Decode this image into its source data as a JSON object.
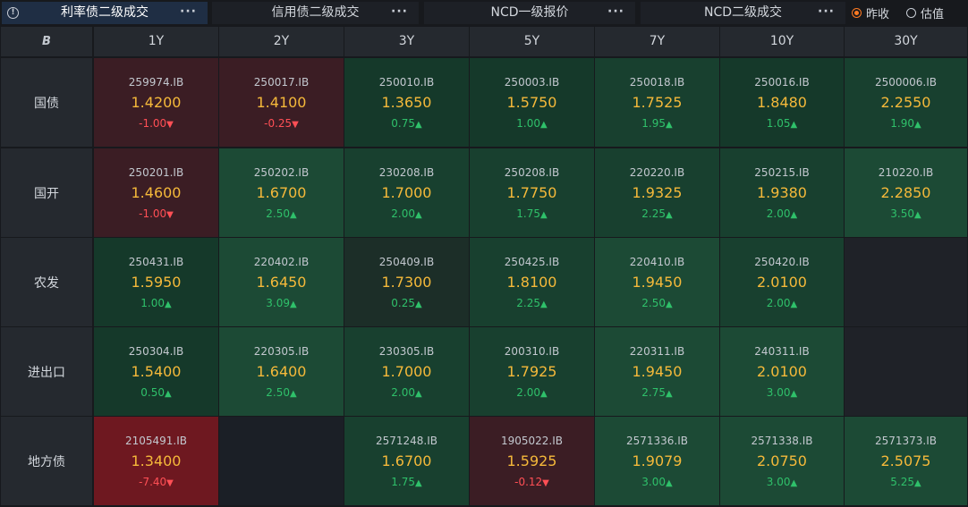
{
  "tabs": [
    {
      "label": "利率债二级成交",
      "active": true
    },
    {
      "label": "信用债二级成交",
      "active": false
    },
    {
      "label": "NCD一级报价",
      "active": false
    },
    {
      "label": "NCD二级成交",
      "active": false
    }
  ],
  "radio": {
    "option1": "昨收",
    "option2": "估值",
    "selected": "昨收"
  },
  "colors": {
    "up": "#2fc06a",
    "down": "#ff4f55",
    "price": "#f5b93a",
    "accent": "#ff7a22"
  },
  "grid": {
    "corner_icon": "B",
    "tenors": [
      "1Y",
      "2Y",
      "3Y",
      "5Y",
      "7Y",
      "10Y",
      "30Y"
    ],
    "rows": [
      {
        "label": "国债",
        "cells": [
          {
            "code": "259974.IB",
            "price": "1.4200",
            "change": "-1.00",
            "dir": "down"
          },
          {
            "code": "250017.IB",
            "price": "1.4100",
            "change": "-0.25",
            "dir": "down"
          },
          {
            "code": "250010.IB",
            "price": "1.3650",
            "change": "0.75",
            "dir": "up"
          },
          {
            "code": "250003.IB",
            "price": "1.5750",
            "change": "1.00",
            "dir": "up"
          },
          {
            "code": "250018.IB",
            "price": "1.7525",
            "change": "1.95",
            "dir": "up"
          },
          {
            "code": "250016.IB",
            "price": "1.8480",
            "change": "1.05",
            "dir": "up"
          },
          {
            "code": "2500006.IB",
            "price": "2.2550",
            "change": "1.90",
            "dir": "up"
          }
        ]
      },
      {
        "label": "国开",
        "cells": [
          {
            "code": "250201.IB",
            "price": "1.4600",
            "change": "-1.00",
            "dir": "down"
          },
          {
            "code": "250202.IB",
            "price": "1.6700",
            "change": "2.50",
            "dir": "up"
          },
          {
            "code": "230208.IB",
            "price": "1.7000",
            "change": "2.00",
            "dir": "up"
          },
          {
            "code": "250208.IB",
            "price": "1.7750",
            "change": "1.75",
            "dir": "up"
          },
          {
            "code": "220220.IB",
            "price": "1.9325",
            "change": "2.25",
            "dir": "up"
          },
          {
            "code": "250215.IB",
            "price": "1.9380",
            "change": "2.00",
            "dir": "up"
          },
          {
            "code": "210220.IB",
            "price": "2.2850",
            "change": "3.50",
            "dir": "up"
          }
        ]
      },
      {
        "label": "农发",
        "cells": [
          {
            "code": "250431.IB",
            "price": "1.5950",
            "change": "1.00",
            "dir": "up"
          },
          {
            "code": "220402.IB",
            "price": "1.6450",
            "change": "3.09",
            "dir": "up"
          },
          {
            "code": "250409.IB",
            "price": "1.7300",
            "change": "0.25",
            "dir": "up"
          },
          {
            "code": "250425.IB",
            "price": "1.8100",
            "change": "2.25",
            "dir": "up"
          },
          {
            "code": "220410.IB",
            "price": "1.9450",
            "change": "2.50",
            "dir": "up"
          },
          {
            "code": "250420.IB",
            "price": "2.0100",
            "change": "2.00",
            "dir": "up"
          },
          null
        ]
      },
      {
        "label": "进出口",
        "cells": [
          {
            "code": "250304.IB",
            "price": "1.5400",
            "change": "0.50",
            "dir": "up"
          },
          {
            "code": "220305.IB",
            "price": "1.6400",
            "change": "2.50",
            "dir": "up"
          },
          {
            "code": "230305.IB",
            "price": "1.7000",
            "change": "2.00",
            "dir": "up"
          },
          {
            "code": "200310.IB",
            "price": "1.7925",
            "change": "2.00",
            "dir": "up"
          },
          {
            "code": "220311.IB",
            "price": "1.9450",
            "change": "2.75",
            "dir": "up"
          },
          {
            "code": "240311.IB",
            "price": "2.0100",
            "change": "3.00",
            "dir": "up"
          },
          null
        ]
      },
      {
        "label": "地方债",
        "cells": [
          {
            "code": "2105491.IB",
            "price": "1.3400",
            "change": "-7.40",
            "dir": "down"
          },
          null,
          {
            "code": "2571248.IB",
            "price": "1.6700",
            "change": "1.75",
            "dir": "up"
          },
          {
            "code": "1905022.IB",
            "price": "1.5925",
            "change": "-0.12",
            "dir": "down"
          },
          {
            "code": "2571336.IB",
            "price": "1.9079",
            "change": "3.00",
            "dir": "up"
          },
          {
            "code": "2571338.IB",
            "price": "2.0750",
            "change": "3.00",
            "dir": "up"
          },
          {
            "code": "2571373.IB",
            "price": "2.5075",
            "change": "5.25",
            "dir": "up"
          }
        ]
      }
    ]
  }
}
